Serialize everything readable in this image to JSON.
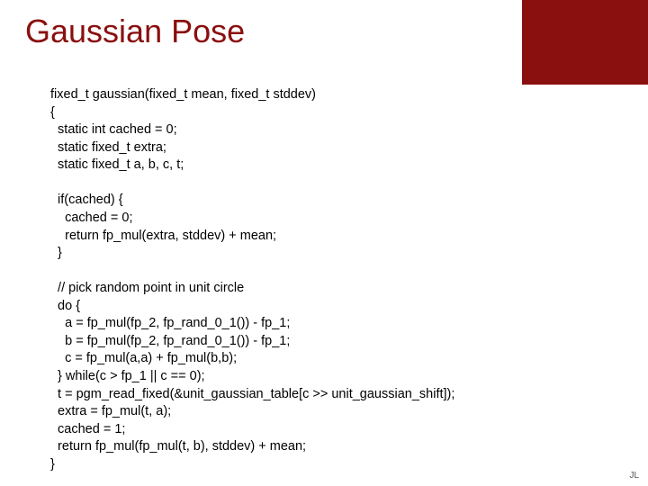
{
  "title": "Gaussian Pose",
  "code": "fixed_t gaussian(fixed_t mean, fixed_t stddev)\n{\n  static int cached = 0;\n  static fixed_t extra;\n  static fixed_t a, b, c, t;\n\n  if(cached) {\n    cached = 0;\n    return fp_mul(extra, stddev) + mean;\n  }\n\n  // pick random point in unit circle\n  do {\n    a = fp_mul(fp_2, fp_rand_0_1()) - fp_1;\n    b = fp_mul(fp_2, fp_rand_0_1()) - fp_1;\n    c = fp_mul(a,a) + fp_mul(b,b);\n  } while(c > fp_1 || c == 0);\n  t = pgm_read_fixed(&unit_gaussian_table[c >> unit_gaussian_shift]);\n  extra = fp_mul(t, a);\n  cached = 1;\n  return fp_mul(fp_mul(t, b), stddev) + mean;\n}",
  "footer": "JL"
}
